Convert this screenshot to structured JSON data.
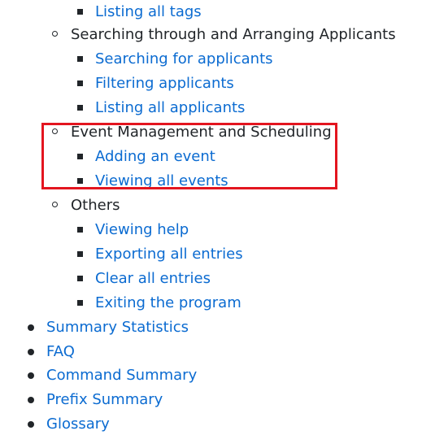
{
  "toc": {
    "tags_items": [
      {
        "label": "Listing all tags"
      }
    ],
    "sections": [
      {
        "title": "Searching through and Arranging Applicants",
        "items": [
          {
            "label": "Searching for applicants"
          },
          {
            "label": "Filtering applicants"
          },
          {
            "label": "Listing all applicants"
          }
        ]
      },
      {
        "title": "Event Management and Scheduling",
        "items": [
          {
            "label": "Adding an event"
          },
          {
            "label": "Viewing all events"
          }
        ]
      },
      {
        "title": "Others",
        "items": [
          {
            "label": "Viewing help"
          },
          {
            "label": "Exporting all entries"
          },
          {
            "label": "Clear all entries"
          },
          {
            "label": "Exiting the program"
          }
        ]
      }
    ],
    "top_level": [
      {
        "label": "Summary Statistics"
      },
      {
        "label": "FAQ"
      },
      {
        "label": "Command Summary"
      },
      {
        "label": "Prefix Summary"
      },
      {
        "label": "Glossary"
      }
    ]
  },
  "colors": {
    "link": "#0b6bd1",
    "text": "#212529",
    "highlight_border": "#e3151f"
  }
}
